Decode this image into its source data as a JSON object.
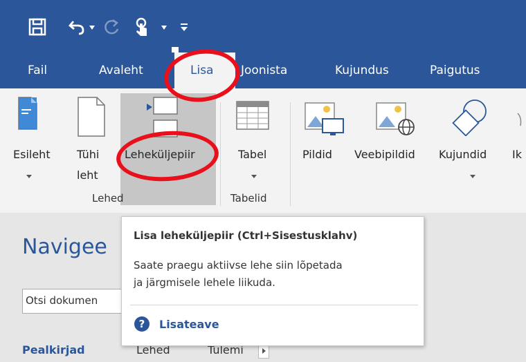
{
  "quick_access": {
    "icons": [
      "save-icon",
      "undo-icon",
      "undo-dropdown-icon",
      "redo-icon",
      "touch-mode-icon",
      "touch-dropdown-icon",
      "customize-toolbar-icon"
    ]
  },
  "tabs": [
    {
      "label": "Fail"
    },
    {
      "label": "Avaleht"
    },
    {
      "label": "Lisa"
    },
    {
      "label": "Joonista"
    },
    {
      "label": "Kujundus"
    },
    {
      "label": "Paigutus"
    }
  ],
  "ribbon": {
    "esileht": "Esileht",
    "tuhi_line1": "Tühi",
    "tuhi_line2": "leht",
    "lehekuljepiir": "Leheküljepiir",
    "tabel": "Tabel",
    "pildid": "Pildid",
    "veebipildid": "Veebipildid",
    "kujundid": "Kujundid",
    "ikoonid_partial": "Ik",
    "group_lehed": "Lehed",
    "group_tabelid": "Tabelid"
  },
  "nav_pane": {
    "title": "Navigee",
    "search_value": "Otsi dokumen",
    "tab_pealkirjad": "Pealkirjad",
    "tab_lehed": "Lehed",
    "tab_tulemused": "Tulemi"
  },
  "tooltip": {
    "title": "Lisa leheküljepiir (Ctrl+Sisestusklahv)",
    "body_line1": "Saate praegu aktiivse lehe siin lõpetada",
    "body_line2": "ja järgmisele lehele liikuda.",
    "help_link": "Lisateave"
  },
  "colors": {
    "title_bar": "#2b579a",
    "ribbon_bg": "#f3f3f3",
    "highlight": "#c6c6c6",
    "annotation": "#e8101b",
    "help_blue": "#2b579a"
  }
}
